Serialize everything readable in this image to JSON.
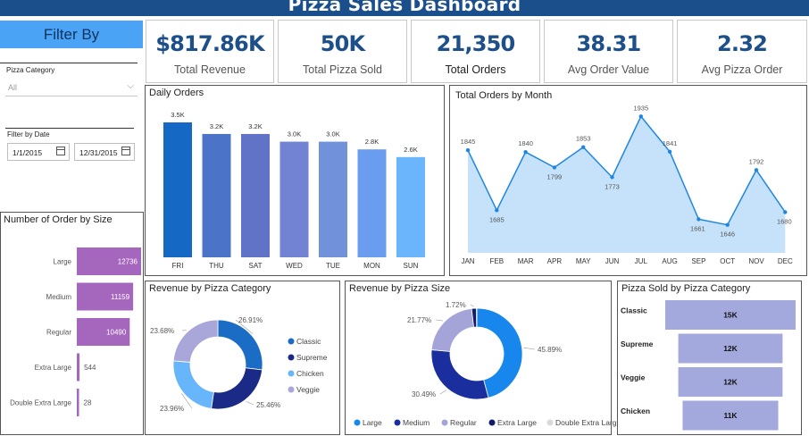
{
  "header": {
    "title": "Pizza Sales Dashboard"
  },
  "filters": {
    "title": "Filter By",
    "category_label": "Pizza Category",
    "category_value": "All",
    "date_label": "Filter by Date",
    "date_start": "1/1/2015",
    "date_end": "12/31/2015"
  },
  "kpis": [
    {
      "value": "$817.86K",
      "label": "Total Revenue"
    },
    {
      "value": "50K",
      "label": "Total Pizza Sold"
    },
    {
      "value": "21,350",
      "label": "Total Orders"
    },
    {
      "value": "38.31",
      "label": "Avg Order Value"
    },
    {
      "value": "2.32",
      "label": "Avg Pizza Order"
    }
  ],
  "colors": {
    "header": "#1a4f8c",
    "filter": "#4aa3f5",
    "size_bar": "#a566bd",
    "month_line": "#1f86e0",
    "month_area": "#c6e2fa",
    "category_bar": "#a3a8dd"
  },
  "chart_data": [
    {
      "id": "size",
      "type": "bar",
      "orientation": "horizontal",
      "title": "Number of Order by Size",
      "categories": [
        "Large",
        "Medium",
        "Regular",
        "Extra Large",
        "Double Extra Large"
      ],
      "values": [
        12736,
        11159,
        10490,
        544,
        28
      ],
      "labels": [
        "12736",
        "11159",
        "10490",
        "544",
        "28"
      ],
      "xlim": [
        0,
        12736
      ]
    },
    {
      "id": "daily",
      "type": "bar",
      "title": "Daily Orders",
      "categories": [
        "FRI",
        "THU",
        "SAT",
        "WED",
        "TUE",
        "MON",
        "SUN"
      ],
      "values": [
        3.5,
        3.2,
        3.2,
        3.0,
        3.0,
        2.8,
        2.6
      ],
      "labels": [
        "3.5K",
        "3.2K",
        "3.2K",
        "3.0K",
        "3.0K",
        "2.8K",
        "2.6K"
      ],
      "colors": [
        "#1568c4",
        "#4b74c9",
        "#6173c6",
        "#7383d3",
        "#7291db",
        "#6a9df0",
        "#6ab5fb"
      ],
      "ylim": [
        0,
        3.5
      ]
    },
    {
      "id": "month",
      "type": "area",
      "title": "Total Orders by Month",
      "categories": [
        "JAN",
        "FEB",
        "MAR",
        "APR",
        "MAY",
        "JUN",
        "JUL",
        "AUG",
        "SEP",
        "OCT",
        "NOV",
        "DEC"
      ],
      "values": [
        1845,
        1685,
        1840,
        1799,
        1853,
        1773,
        1935,
        1841,
        1661,
        1646,
        1792,
        1680
      ],
      "ylim": [
        1600,
        1950
      ]
    },
    {
      "id": "cat_rev",
      "type": "pie",
      "title": "Revenue by Pizza Category",
      "labels": [
        "Classic",
        "Supreme",
        "Chicken",
        "Veggie"
      ],
      "values": [
        26.91,
        25.46,
        23.96,
        23.68
      ],
      "value_labels": [
        "26.91%",
        "25.46%",
        "23.96%",
        "23.68%"
      ],
      "colors": [
        "#1a6cc4",
        "#1b2a86",
        "#67b6fb",
        "#a9a7d9"
      ],
      "legend": "right"
    },
    {
      "id": "size_rev",
      "type": "pie",
      "title": "Revenue by Pizza Size",
      "labels": [
        "Large",
        "Medium",
        "Regular",
        "Extra Large",
        "Double Extra Large"
      ],
      "values": [
        45.89,
        30.49,
        21.77,
        1.72,
        0.12
      ],
      "value_labels": [
        "45.89%",
        "30.49%",
        "21.77%",
        "1.72%",
        ""
      ],
      "colors": [
        "#1787ee",
        "#1a2e9e",
        "#a4a4d8",
        "#111d6a",
        "#d9d9d9"
      ],
      "legend": "bottom"
    },
    {
      "id": "cat_sold",
      "type": "bar",
      "orientation": "horizontal",
      "title": "Pizza Sold by Pizza Category",
      "categories": [
        "Classic",
        "Supreme",
        "Veggie",
        "Chicken"
      ],
      "values": [
        15,
        12,
        12,
        11
      ],
      "labels": [
        "15K",
        "12K",
        "12K",
        "11K"
      ]
    }
  ]
}
